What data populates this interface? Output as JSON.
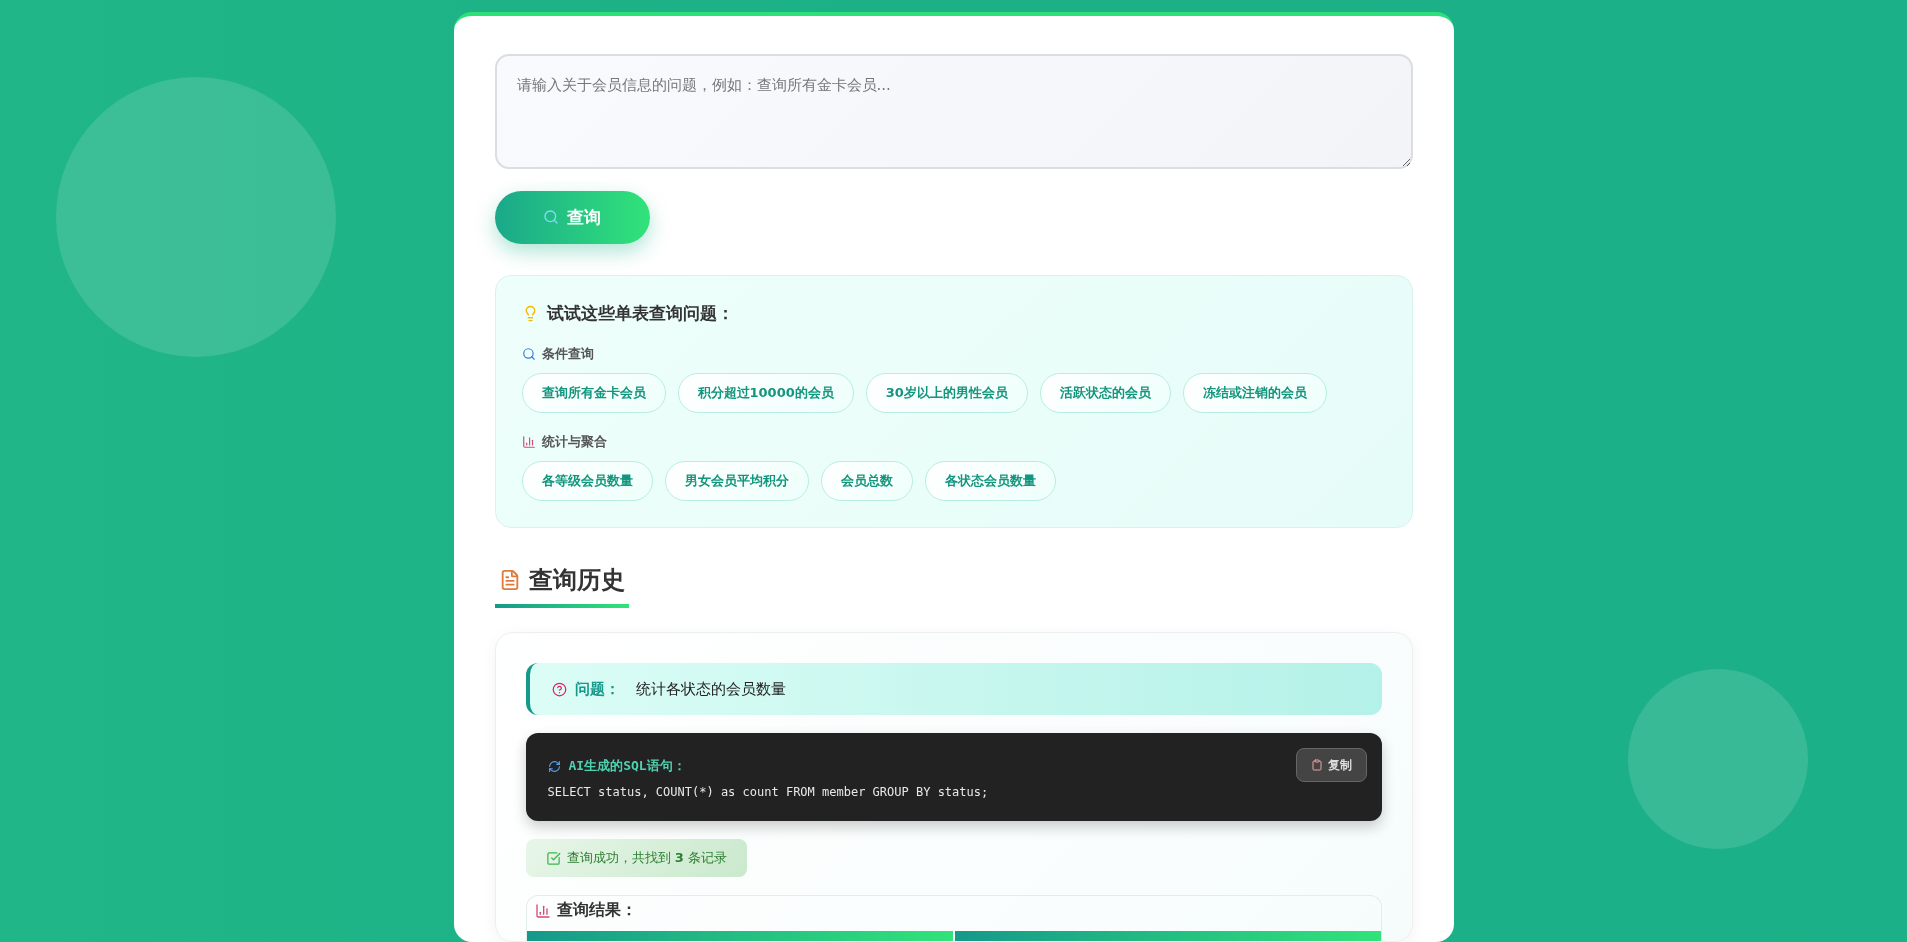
{
  "query": {
    "placeholder": "请输入关于会员信息的问题，例如：查询所有金卡会员...",
    "button": "查询"
  },
  "suggestions": {
    "title": "试试这些单表查询问题：",
    "groups": [
      {
        "kind": "search",
        "label": "条件查询",
        "items": [
          "查询所有金卡会员",
          "积分超过10000的会员",
          "30岁以上的男性会员",
          "活跃状态的会员",
          "冻结或注销的会员"
        ]
      },
      {
        "kind": "stats",
        "label": "统计与聚合",
        "items": [
          "各等级会员数量",
          "男女会员平均积分",
          "会员总数",
          "各状态会员数量"
        ]
      }
    ]
  },
  "history": {
    "title": "查询历史",
    "entries": [
      {
        "question_label": "问题：",
        "question": "统计各状态的会员数量",
        "sql_label": "AI生成的SQL语句：",
        "copy_button": "复制",
        "sql": "SELECT status, COUNT(*) as count FROM member GROUP BY status;",
        "success": true,
        "status_text": "查询成功，共找到 **3** 条记录",
        "result_title": "查询结果："
      }
    ]
  }
}
